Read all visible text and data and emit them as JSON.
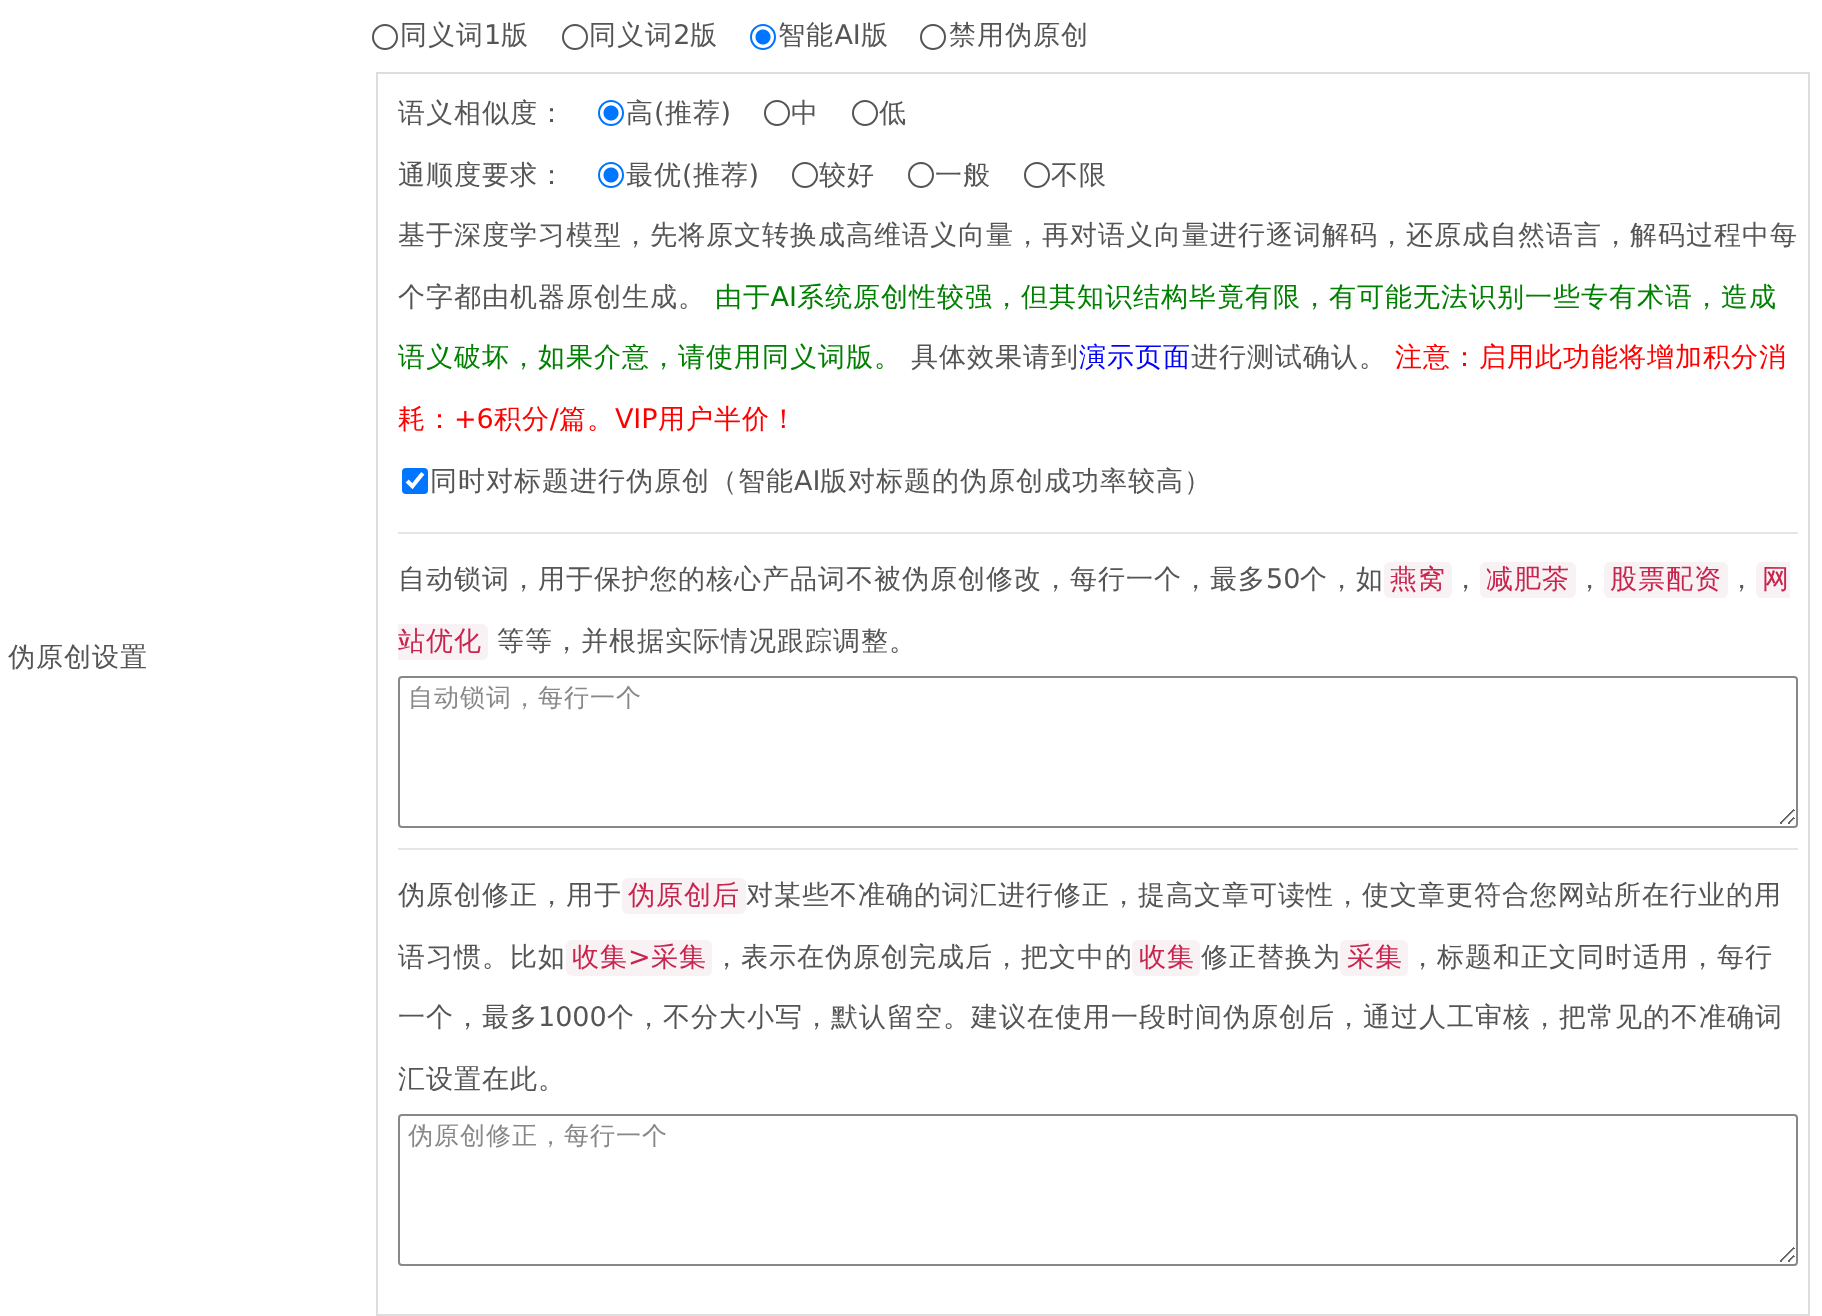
{
  "section_label": "伪原创设置",
  "mode_options": [
    {
      "label": "同义词1版",
      "selected": false
    },
    {
      "label": "同义词2版",
      "selected": false
    },
    {
      "label": "智能AI版",
      "selected": true
    },
    {
      "label": "禁用伪原创",
      "selected": false
    }
  ],
  "similarity": {
    "label": "语义相似度：",
    "options": [
      {
        "label": "高(推荐)",
        "selected": true
      },
      {
        "label": "中",
        "selected": false
      },
      {
        "label": "低",
        "selected": false
      }
    ]
  },
  "fluency": {
    "label": "通顺度要求：",
    "options": [
      {
        "label": "最优(推荐)",
        "selected": true
      },
      {
        "label": "较好",
        "selected": false
      },
      {
        "label": "一般",
        "selected": false
      },
      {
        "label": "不限",
        "selected": false
      }
    ]
  },
  "ai_description": [
    {
      "kind": "plain",
      "text": "基于深度学习模型，先将原文转换成高维语义向量，再对语义向量进行逐词解码，还原成自然语言，解码过程中每个字都由机器原创生成。 "
    },
    {
      "kind": "notice",
      "text": "由于AI系统原创性较强，但其知识结构毕竟有限，有可能无法识别一些专有术语，造成语义破坏，如果介意，请使用同义词版。"
    },
    {
      "kind": "plain",
      "text": " 具体效果请到"
    },
    {
      "kind": "link",
      "text": "演示页面"
    },
    {
      "kind": "plain",
      "text": "进行测试确认。 "
    },
    {
      "kind": "warning",
      "text": "注意：启用此功能将增加积分消耗：+6积分/篇。VIP用户半价！"
    }
  ],
  "title_option": {
    "label": "同时对标题进行伪原创（智能AI版对标题的伪原创成功率较高）",
    "checked": true
  },
  "lock_words": {
    "description": [
      {
        "kind": "plain",
        "text": "自动锁词，用于保护您的核心产品词不被伪原创修改，每行一个，最多50个，如"
      },
      {
        "kind": "tag",
        "text": "燕窝"
      },
      {
        "kind": "plain",
        "text": "，"
      },
      {
        "kind": "tag",
        "text": "减肥茶"
      },
      {
        "kind": "plain",
        "text": "，"
      },
      {
        "kind": "tag",
        "text": "股票配资"
      },
      {
        "kind": "plain",
        "text": "，"
      },
      {
        "kind": "tag",
        "text": "网站优化"
      },
      {
        "kind": "plain",
        "text": " 等等，并根据实际情况跟踪调整。"
      }
    ],
    "placeholder": "自动锁词，每行一个"
  },
  "correction": {
    "description": [
      {
        "kind": "plain",
        "text": "伪原创修正，用于"
      },
      {
        "kind": "tag",
        "text": "伪原创后"
      },
      {
        "kind": "plain",
        "text": "对某些不准确的词汇进行修正，提高文章可读性，使文章更符合您网站所在行业的用语习惯。比如"
      },
      {
        "kind": "tag",
        "text": "收集>采集"
      },
      {
        "kind": "plain",
        "text": "，表示在伪原创完成后，把文中的"
      },
      {
        "kind": "tag",
        "text": "收集"
      },
      {
        "kind": "plain",
        "text": "修正替换为"
      },
      {
        "kind": "tag",
        "text": "采集"
      },
      {
        "kind": "plain",
        "text": "，标题和正文同时适用，每行一个，最多1000个，不分大小写，默认留空。建议在使用一段时间伪原创后，通过人工审核，把常见的不准确词汇设置在此。"
      }
    ],
    "placeholder": "伪原创修正，每行一个"
  }
}
